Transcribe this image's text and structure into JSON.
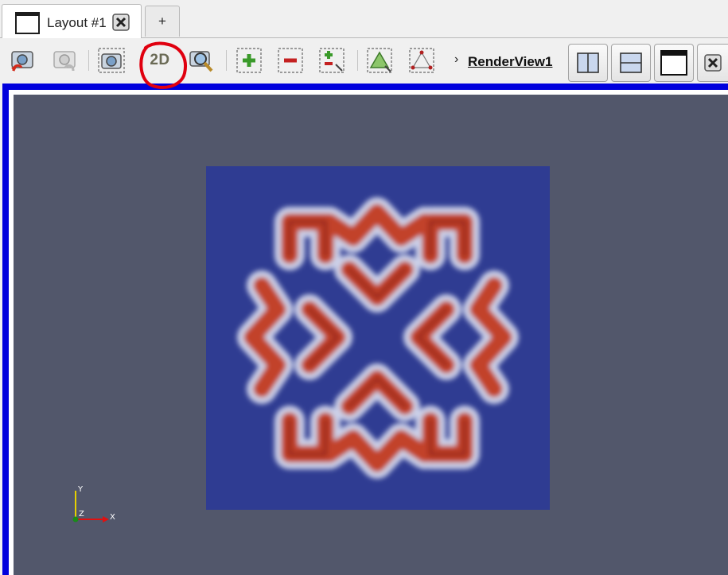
{
  "tabs": {
    "active_label": "Layout #1",
    "add_label": "+"
  },
  "toolbar": {
    "buttons": [
      {
        "name": "reset-camera-undo-icon"
      },
      {
        "name": "reset-camera-redo-icon"
      },
      {
        "name": "capture-screenshot-icon"
      },
      {
        "name": "toggle-2d-3d-button",
        "label": "2D"
      },
      {
        "name": "zoom-to-data-icon"
      },
      {
        "name": "select-cells-on-icon"
      },
      {
        "name": "select-cells-off-icon"
      },
      {
        "name": "select-interactive-icon"
      },
      {
        "name": "select-block-icon"
      },
      {
        "name": "select-points-icon"
      }
    ],
    "render_view_label": "RenderView1",
    "chevron": "›"
  },
  "layout_buttons": [
    {
      "name": "split-horizontal-icon"
    },
    {
      "name": "split-vertical-icon"
    },
    {
      "name": "maximize-icon"
    },
    {
      "name": "close-view-icon"
    }
  ],
  "colors": {
    "view_background": "#52576b",
    "view_border": "#0000dd",
    "plot_background": "#2f3c92",
    "pattern_high": "#c2432b",
    "pattern_edge": "#ffffff",
    "annotation": "#e0000f"
  },
  "axes": {
    "x": "X",
    "y": "Y",
    "z": "Z"
  }
}
